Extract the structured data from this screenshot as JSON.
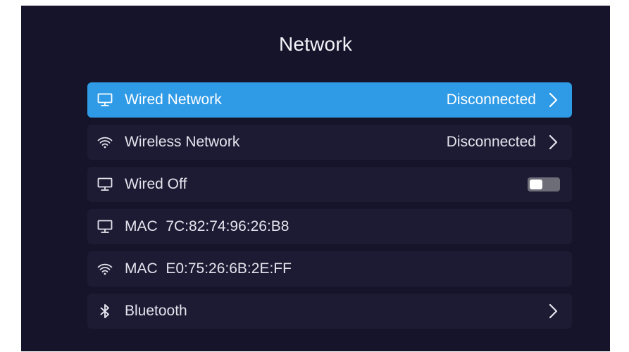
{
  "screen": {
    "title": "Network"
  },
  "colors": {
    "background": "#15142a",
    "row_background": "#1c1b33",
    "selected_background": "#2f9ae6",
    "toggle_off": "#6d6d78"
  },
  "rows": [
    {
      "icon": "monitor-icon",
      "label": "Wired Network",
      "status": "Disconnected",
      "has_chevron": true,
      "selected": true
    },
    {
      "icon": "wifi-icon",
      "label": "Wireless Network",
      "status": "Disconnected",
      "has_chevron": true,
      "selected": false
    },
    {
      "icon": "monitor-icon",
      "label": "Wired Off",
      "toggle": "off",
      "selected": false
    },
    {
      "icon": "monitor-icon",
      "label": "MAC  7C:82:74:96:26:B8",
      "selected": false
    },
    {
      "icon": "wifi-icon",
      "label": "MAC  E0:75:26:6B:2E:FF",
      "selected": false
    },
    {
      "icon": "bluetooth-icon",
      "label": "Bluetooth",
      "has_chevron": true,
      "selected": false
    }
  ]
}
